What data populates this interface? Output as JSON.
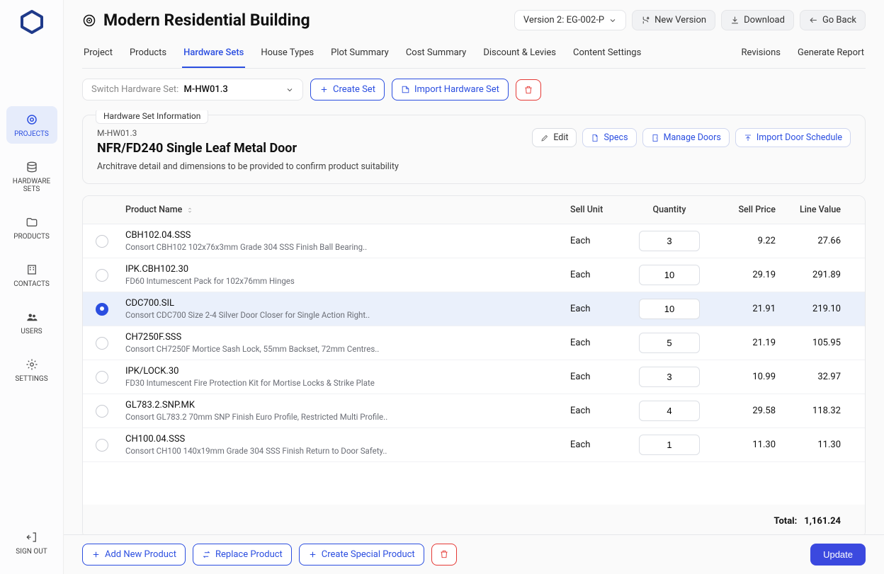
{
  "sidebar": {
    "items": [
      {
        "label": "PROJECTS"
      },
      {
        "label": "HARDWARE SETS"
      },
      {
        "label": "PRODUCTS"
      },
      {
        "label": "CONTACTS"
      },
      {
        "label": "USERS"
      },
      {
        "label": "SETTINGS"
      }
    ],
    "signout": "SIGN OUT"
  },
  "header": {
    "title": "Modern Residential Building",
    "version_selector": "Version 2: EG-002-P",
    "new_version": "New Version",
    "download": "Download",
    "go_back": "Go Back"
  },
  "tabs": [
    {
      "label": "Project"
    },
    {
      "label": "Products"
    },
    {
      "label": "Hardware Sets"
    },
    {
      "label": "House Types"
    },
    {
      "label": "Plot Summary"
    },
    {
      "label": "Cost Summary"
    },
    {
      "label": "Discount & Levies"
    },
    {
      "label": "Content Settings"
    }
  ],
  "tabs_right": [
    {
      "label": "Revisions"
    },
    {
      "label": "Generate Report"
    }
  ],
  "toolbar": {
    "switch_label": "Switch Hardware Set:",
    "switch_value": "M-HW01.3",
    "create_set": "Create Set",
    "import_set": "Import Hardware Set"
  },
  "info": {
    "legend": "Hardware Set Information",
    "code": "M-HW01.3",
    "title": "NFR/FD240 Single Leaf Metal Door",
    "note": "Architrave detail and dimensions to be provided to confirm product suitability",
    "actions": {
      "edit": "Edit",
      "specs": "Specs",
      "manage_doors": "Manage Doors",
      "import_schedule": "Import Door Schedule"
    }
  },
  "table": {
    "headers": {
      "name": "Product Name",
      "unit": "Sell Unit",
      "qty": "Quantity",
      "price": "Sell Price",
      "value": "Line Value"
    },
    "rows": [
      {
        "code": "CBH102.04.SSS",
        "desc": "Consort CBH102 102x76x3mm Grade 304 SSS Finish Ball Bearing..",
        "unit": "Each",
        "qty": "3",
        "price": "9.22",
        "value": "27.66",
        "selected": false
      },
      {
        "code": "IPK.CBH102.30",
        "desc": "FD60 Intumescent Pack for 102x76mm Hinges",
        "unit": "Each",
        "qty": "10",
        "price": "29.19",
        "value": "291.89",
        "selected": false
      },
      {
        "code": "CDC700.SIL",
        "desc": "Consort CDC700 Size 2-4 Silver Door Closer for Single Action Right..",
        "unit": "Each",
        "qty": "10",
        "price": "21.91",
        "value": "219.10",
        "selected": true
      },
      {
        "code": "CH7250F.SSS",
        "desc": "Consort CH7250F Mortice Sash Lock, 55mm Backset, 72mm Centres..",
        "unit": "Each",
        "qty": "5",
        "price": "21.19",
        "value": "105.95",
        "selected": false
      },
      {
        "code": "IPK/LOCK.30",
        "desc": "FD30 Intumescent Fire Protection Kit for Mortise Locks & Strike Plate",
        "unit": "Each",
        "qty": "3",
        "price": "10.99",
        "value": "32.97",
        "selected": false
      },
      {
        "code": "GL783.2.SNP.MK",
        "desc": "Consort GL783.2 70mm SNP Finish Euro Profile, Restricted Multi Profile..",
        "unit": "Each",
        "qty": "4",
        "price": "29.58",
        "value": "118.32",
        "selected": false
      },
      {
        "code": "CH100.04.SSS",
        "desc": "Consort CH100 140x19mm Grade 304 SSS Finish Return to Door Safety..",
        "unit": "Each",
        "qty": "1",
        "price": "11.30",
        "value": "11.30",
        "selected": false
      }
    ],
    "total_label": "Total:",
    "total_value": "1,161.24"
  },
  "bottombar": {
    "add_product": "Add New Product",
    "replace_product": "Replace Product",
    "create_special": "Create Special Product",
    "update": "Update"
  }
}
